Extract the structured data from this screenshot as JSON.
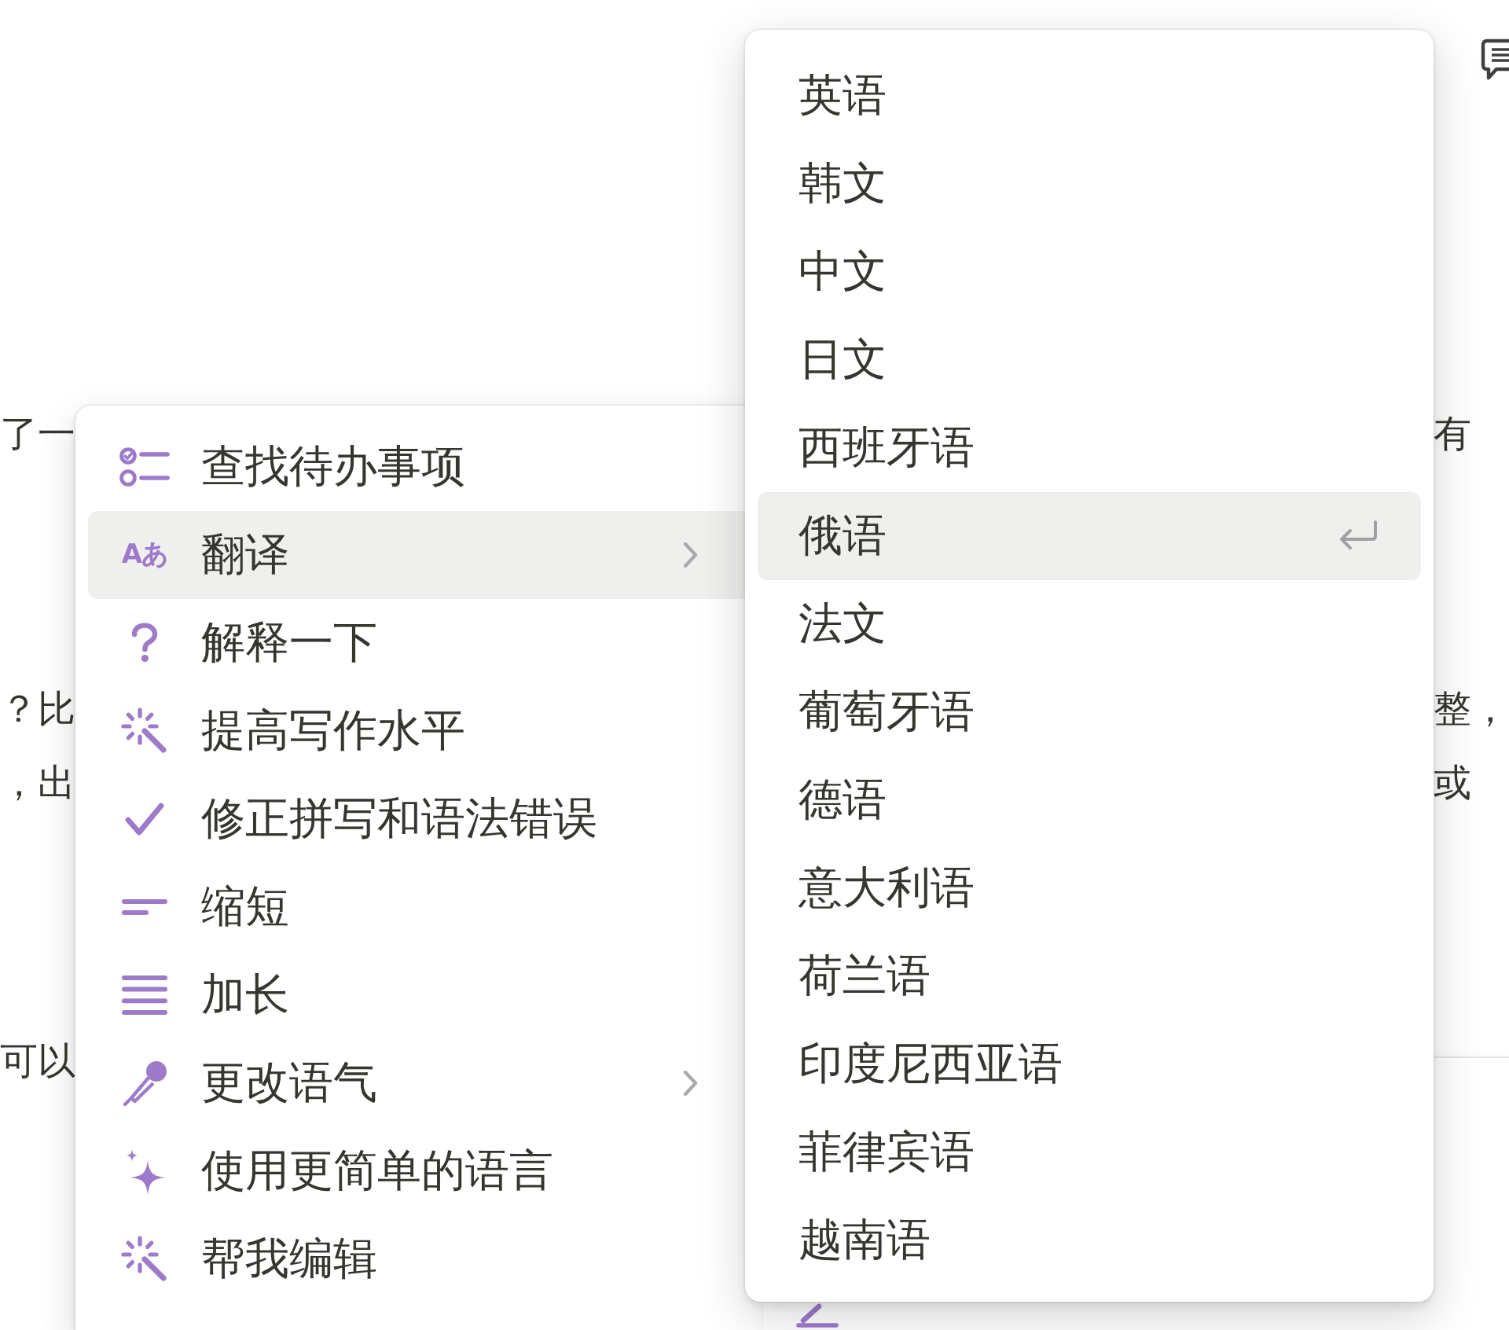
{
  "document": {
    "lines": [
      {
        "left": "了一",
        "right": "有"
      },
      {
        "left": "？比",
        "right": "整，"
      },
      {
        "left": "，出",
        "right": "或"
      },
      {
        "left": "可以"
      }
    ]
  },
  "ai_menu": {
    "items": [
      {
        "label": "查找待办事项",
        "has_submenu": false,
        "selected": false
      },
      {
        "label": "翻译",
        "glyph": "Aあ",
        "has_submenu": true,
        "selected": true
      },
      {
        "label": "解释一下",
        "has_submenu": false,
        "selected": false
      },
      {
        "label": "提高写作水平",
        "has_submenu": false,
        "selected": false
      },
      {
        "label": "修正拼写和语法错误",
        "has_submenu": false,
        "selected": false
      },
      {
        "label": "缩短",
        "has_submenu": false,
        "selected": false
      },
      {
        "label": "加长",
        "has_submenu": false,
        "selected": false
      },
      {
        "label": "更改语气",
        "has_submenu": true,
        "selected": false
      },
      {
        "label": "使用更简单的语言",
        "has_submenu": false,
        "selected": false
      },
      {
        "label": "帮我编辑",
        "has_submenu": false,
        "selected": false
      }
    ]
  },
  "translate_menu": {
    "items": [
      {
        "label": "英语",
        "selected": false
      },
      {
        "label": "韩文",
        "selected": false
      },
      {
        "label": "中文",
        "selected": false
      },
      {
        "label": "日文",
        "selected": false
      },
      {
        "label": "西班牙语",
        "selected": false
      },
      {
        "label": "俄语",
        "selected": true
      },
      {
        "label": "法文",
        "selected": false
      },
      {
        "label": "葡萄牙语",
        "selected": false
      },
      {
        "label": "德语",
        "selected": false
      },
      {
        "label": "意大利语",
        "selected": false
      },
      {
        "label": "荷兰语",
        "selected": false
      },
      {
        "label": "印度尼西亚语",
        "selected": false
      },
      {
        "label": "菲律宾语",
        "selected": false
      },
      {
        "label": "越南语",
        "selected": false
      }
    ]
  }
}
